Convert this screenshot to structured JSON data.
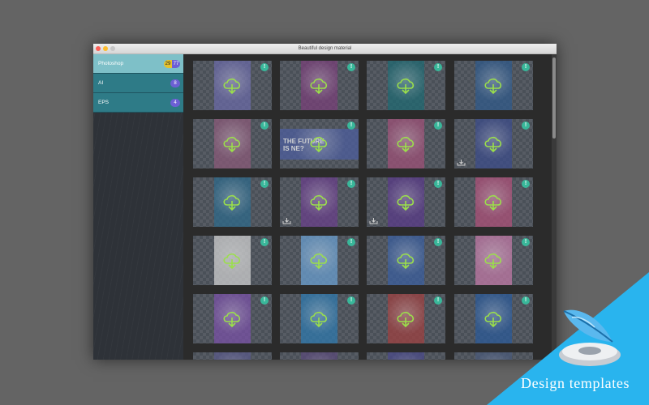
{
  "window": {
    "title": "Beautiful design material"
  },
  "sidebar": {
    "items": [
      {
        "label": "Photoshop",
        "count_a": "29",
        "count_b": "77",
        "active": true
      },
      {
        "label": "AI",
        "count": "8",
        "active": false
      },
      {
        "label": "EPS",
        "count": "4",
        "active": false
      }
    ]
  },
  "tiles": [
    {
      "bg": "#6b6aa8",
      "badge": "!",
      "download": false,
      "wide": false,
      "text": ""
    },
    {
      "bg": "#7a3f7a",
      "badge": "!",
      "download": false,
      "wide": false,
      "text": ""
    },
    {
      "bg": "#1e6a73",
      "badge": "!",
      "download": false,
      "wide": false,
      "text": ""
    },
    {
      "bg": "#2f5a8c",
      "badge": "!",
      "download": false,
      "wide": false,
      "text": ""
    },
    {
      "bg": "#8c5a7a",
      "badge": "!",
      "download": false,
      "wide": false,
      "text": ""
    },
    {
      "bg": "#4d5ea0",
      "badge": "!",
      "download": false,
      "wide": true,
      "text": "THE FUTURE\nIS NE?"
    },
    {
      "bg": "#a05078",
      "badge": "!",
      "download": false,
      "wide": false,
      "text": ""
    },
    {
      "bg": "#3c4c8c",
      "badge": "!",
      "download": true,
      "wide": false,
      "text": ""
    },
    {
      "bg": "#2d6a8c",
      "badge": "!",
      "download": false,
      "wide": false,
      "text": ""
    },
    {
      "bg": "#6a3f8c",
      "badge": "!",
      "download": true,
      "wide": false,
      "text": ""
    },
    {
      "bg": "#5a3a8a",
      "badge": "!",
      "download": true,
      "wide": false,
      "text": ""
    },
    {
      "bg": "#b0507a",
      "badge": "!",
      "download": false,
      "wide": false,
      "text": ""
    },
    {
      "bg": "#d2d2d2",
      "badge": "!",
      "download": false,
      "wide": false,
      "text": ""
    },
    {
      "bg": "#6aa0d2",
      "badge": "!",
      "download": false,
      "wide": false,
      "text": ""
    },
    {
      "bg": "#3a5fa0",
      "badge": "!",
      "download": false,
      "wide": false,
      "text": ""
    },
    {
      "bg": "#c47aa8",
      "badge": "!",
      "download": false,
      "wide": false,
      "text": ""
    },
    {
      "bg": "#7a50a8",
      "badge": "!",
      "download": false,
      "wide": false,
      "text": ""
    },
    {
      "bg": "#2e7ab0",
      "badge": "!",
      "download": false,
      "wide": false,
      "text": ""
    },
    {
      "bg": "#a04040",
      "badge": "!",
      "download": false,
      "wide": false,
      "text": ""
    },
    {
      "bg": "#2a5a9a",
      "badge": "!",
      "download": false,
      "wide": false,
      "text": ""
    },
    {
      "bg": "#5a5a8a",
      "badge": "",
      "download": false,
      "wide": false,
      "text": ""
    },
    {
      "bg": "#5a4a7a",
      "badge": "",
      "download": false,
      "wide": false,
      "text": ""
    },
    {
      "bg": "#4a4a8a",
      "badge": "",
      "download": false,
      "wide": false,
      "text": ""
    },
    {
      "bg": "#4a5a7a",
      "badge": "",
      "download": false,
      "wide": false,
      "text": ""
    }
  ],
  "promo": {
    "label": "Design templates",
    "color": "#29b4ee"
  },
  "icons": {
    "cloud": "cloud-download-icon",
    "badge": "info-badge-icon",
    "download": "download-icon",
    "app": "feather-app-icon"
  }
}
